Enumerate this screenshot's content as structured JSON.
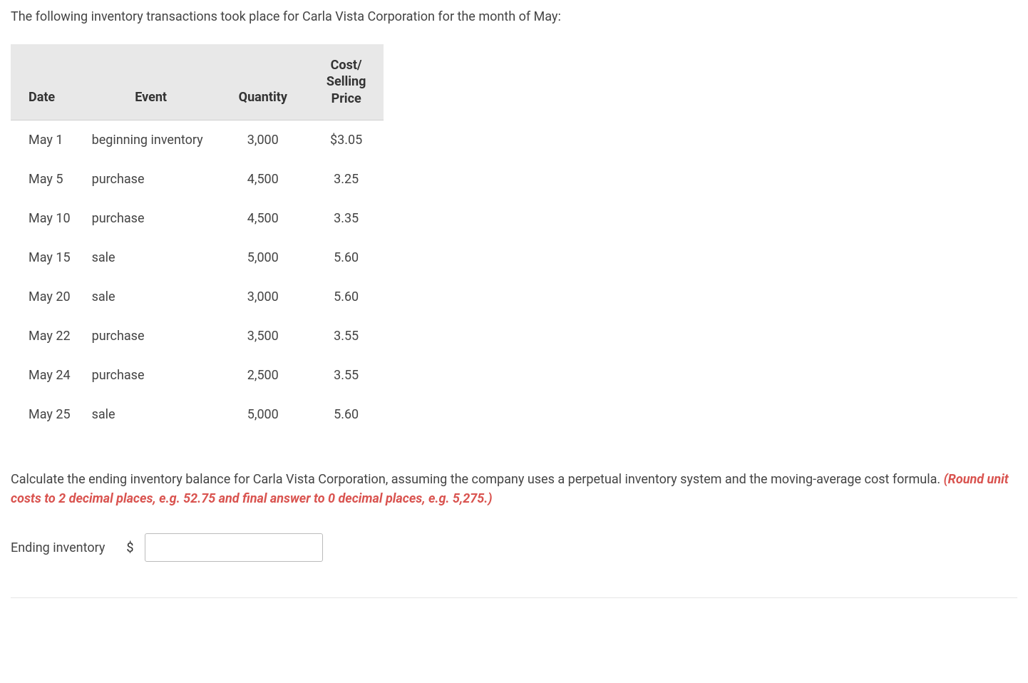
{
  "intro_text": "The following inventory transactions took place for Carla Vista Corporation for the month of May:",
  "table": {
    "headers": {
      "date": "Date",
      "event": "Event",
      "quantity": "Quantity",
      "price_line1": "Cost/",
      "price_line2": "Selling",
      "price_line3": "Price"
    },
    "rows": [
      {
        "date": "May 1",
        "event": "beginning inventory",
        "quantity": "3,000",
        "price": "$3.05"
      },
      {
        "date": "May 5",
        "event": "purchase",
        "quantity": "4,500",
        "price": "3.25"
      },
      {
        "date": "May 10",
        "event": "purchase",
        "quantity": "4,500",
        "price": "3.35"
      },
      {
        "date": "May 15",
        "event": "sale",
        "quantity": "5,000",
        "price": "5.60"
      },
      {
        "date": "May 20",
        "event": "sale",
        "quantity": "3,000",
        "price": "5.60"
      },
      {
        "date": "May 22",
        "event": "purchase",
        "quantity": "3,500",
        "price": "3.55"
      },
      {
        "date": "May 24",
        "event": "purchase",
        "quantity": "2,500",
        "price": "3.55"
      },
      {
        "date": "May 25",
        "event": "sale",
        "quantity": "5,000",
        "price": "5.60"
      }
    ]
  },
  "instruction_text": "Calculate the ending inventory balance for Carla Vista Corporation, assuming the company uses a perpetual inventory system and the moving-average cost formula. ",
  "hint_text": "(Round unit costs to 2 decimal places, e.g. 52.75 and final answer to 0 decimal places, e.g. 5,275.)",
  "answer": {
    "label": "Ending inventory",
    "currency": "$",
    "value": ""
  }
}
